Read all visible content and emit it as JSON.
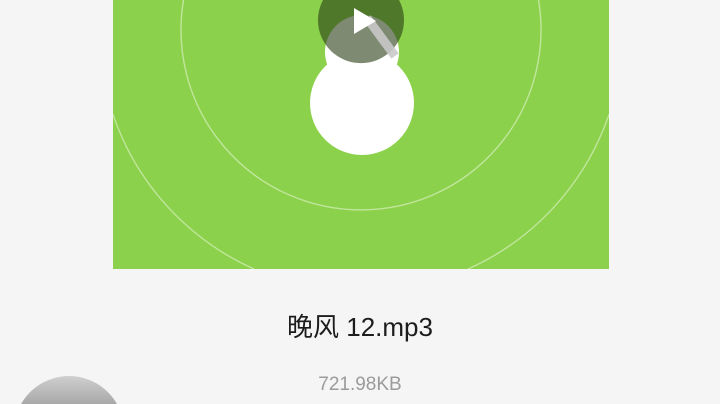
{
  "file": {
    "name": "晚风 12.mp3",
    "size": "721.98KB"
  },
  "cover": {
    "icon": "music-note-icon",
    "play_icon": "play-icon"
  },
  "avatar": {
    "icon": "avatar"
  },
  "colors": {
    "background": "#f5f5f5",
    "cover_green": "#8cd14b",
    "cover_ring": "rgba(255,255,255,0.45)",
    "note": "#ffffff",
    "play_button": "rgba(40,60,20,0.6)",
    "tonearm": "#c9c9c9",
    "title_text": "#1c1c1c",
    "size_text": "#9b9b9b",
    "avatar_light": "#cfcfcf",
    "avatar_dark": "#a8a8a8"
  }
}
